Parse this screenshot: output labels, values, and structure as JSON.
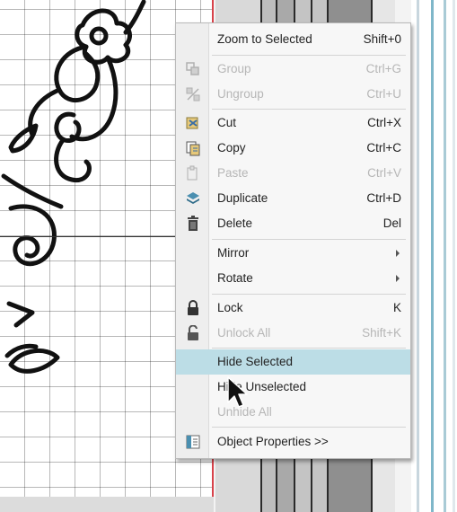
{
  "menu": {
    "items": [
      {
        "label": "Zoom to Selected",
        "shortcut": "Shift+0",
        "enabled": true,
        "icon": ""
      },
      {
        "label": "Group",
        "shortcut": "Ctrl+G",
        "enabled": false,
        "icon": "group-icon"
      },
      {
        "label": "Ungroup",
        "shortcut": "Ctrl+U",
        "enabled": false,
        "icon": "ungroup-icon"
      },
      {
        "label": "Cut",
        "shortcut": "Ctrl+X",
        "enabled": true,
        "icon": "cut-icon"
      },
      {
        "label": "Copy",
        "shortcut": "Ctrl+C",
        "enabled": true,
        "icon": "copy-icon"
      },
      {
        "label": "Paste",
        "shortcut": "Ctrl+V",
        "enabled": false,
        "icon": "paste-icon"
      },
      {
        "label": "Duplicate",
        "shortcut": "Ctrl+D",
        "enabled": true,
        "icon": "duplicate-icon"
      },
      {
        "label": "Delete",
        "shortcut": "Del",
        "enabled": true,
        "icon": "trash-icon"
      },
      {
        "label": "Mirror",
        "shortcut": "",
        "enabled": true,
        "submenu": true
      },
      {
        "label": "Rotate",
        "shortcut": "",
        "enabled": true,
        "submenu": true
      },
      {
        "label": "Lock",
        "shortcut": "K",
        "enabled": true,
        "icon": "lock-icon"
      },
      {
        "label": "Unlock All",
        "shortcut": "Shift+K",
        "enabled": false,
        "icon": "unlock-icon"
      },
      {
        "label": "Hide Selected",
        "shortcut": "",
        "enabled": true,
        "highlighted": true
      },
      {
        "label": "Hide Unselected",
        "shortcut": "",
        "enabled": true
      },
      {
        "label": "Unhide All",
        "shortcut": "",
        "enabled": false
      },
      {
        "label": "Object Properties >>",
        "shortcut": "",
        "enabled": true,
        "icon": "properties-icon"
      }
    ]
  },
  "colors": {
    "highlight": "#bcdde6",
    "accent_red": "#d8424a",
    "disabled_text": "#b6b6b6"
  }
}
